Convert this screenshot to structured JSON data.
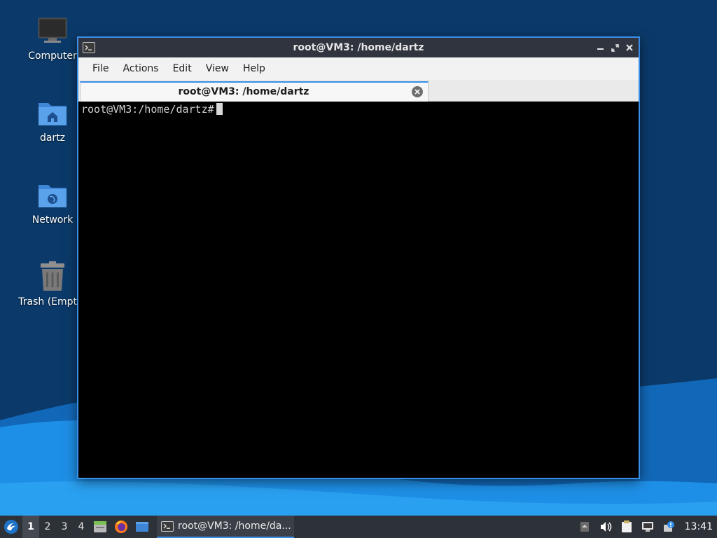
{
  "desktop": {
    "icons": [
      {
        "label": "Computer",
        "icon": "computer-icon"
      },
      {
        "label": "dartz",
        "icon": "home-folder-icon"
      },
      {
        "label": "Network",
        "icon": "network-folder-icon"
      },
      {
        "label": "Trash (Empty)",
        "icon": "trash-icon"
      }
    ],
    "colors": {
      "wallpaper_dark": "#0a3d6e",
      "wallpaper_wave": "#1e8fe6"
    }
  },
  "window": {
    "title": "root@VM3: /home/dartz",
    "app_icon": "terminal-icon",
    "controls": [
      "minimize",
      "maximize",
      "close"
    ],
    "menu": [
      "File",
      "Actions",
      "Edit",
      "View",
      "Help"
    ],
    "tab": {
      "label": "root@VM3: /home/dartz",
      "close_icon": "close-circle-icon"
    },
    "terminal": {
      "prompt": "root@VM3:/home/dartz#"
    }
  },
  "taskbar": {
    "start_icon": "lubuntu-start-icon",
    "workspaces": [
      "1",
      "2",
      "3",
      "4"
    ],
    "active_workspace": "1",
    "launchers": [
      "file-manager-icon",
      "firefox-icon",
      "show-desktop-icon"
    ],
    "task": {
      "label": "root@VM3: /home/da...",
      "icon": "terminal-icon"
    },
    "tray": [
      "notification-arrow-icon",
      "volume-icon",
      "clipboard-icon",
      "network-icon",
      "update-icon"
    ],
    "clock": "13:41",
    "accent": "#3a8ee6"
  }
}
